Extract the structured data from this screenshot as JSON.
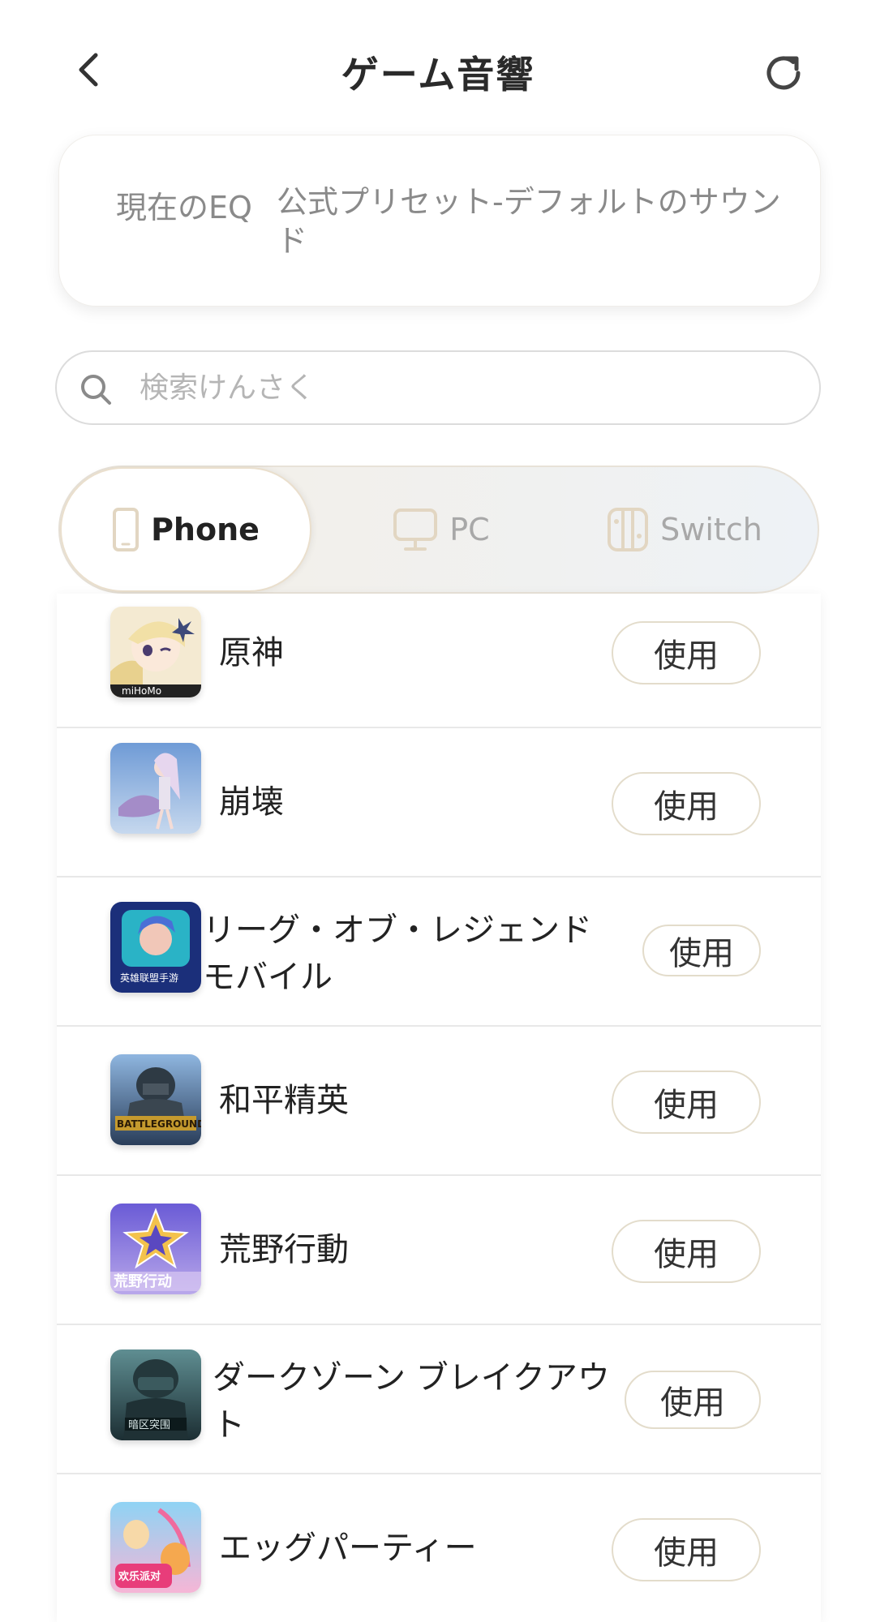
{
  "header": {
    "title": "ゲーム音響"
  },
  "eq_card": {
    "label": "現在のEQ",
    "value": "公式プリセット-デフォルトのサウンド"
  },
  "search": {
    "placeholder": "検索けんさく"
  },
  "segments": [
    {
      "label": "Phone",
      "icon": "phone-icon",
      "active": true
    },
    {
      "label": "PC",
      "icon": "monitor-icon",
      "active": false
    },
    {
      "label": "Switch",
      "icon": "switch-console-icon",
      "active": false
    }
  ],
  "games": [
    {
      "name": "原神",
      "button": "使用",
      "icon_text": "miHoMo"
    },
    {
      "name": "崩壊",
      "button": "使用"
    },
    {
      "name": "リーグ・オブ・レジェンド モバイル",
      "button": "使用",
      "icon_text": "英雄联盟手游"
    },
    {
      "name": "和平精英",
      "button": "使用",
      "icon_text": "BATTLEGROUNDS"
    },
    {
      "name": "荒野行動",
      "button": "使用",
      "icon_text": "荒野行动"
    },
    {
      "name": "ダークゾーン ブレイクアウト",
      "button": "使用",
      "icon_text": "暗区突围"
    },
    {
      "name": "エッグパーティー",
      "button": "使用",
      "icon_text": "欢乐派对"
    }
  ]
}
